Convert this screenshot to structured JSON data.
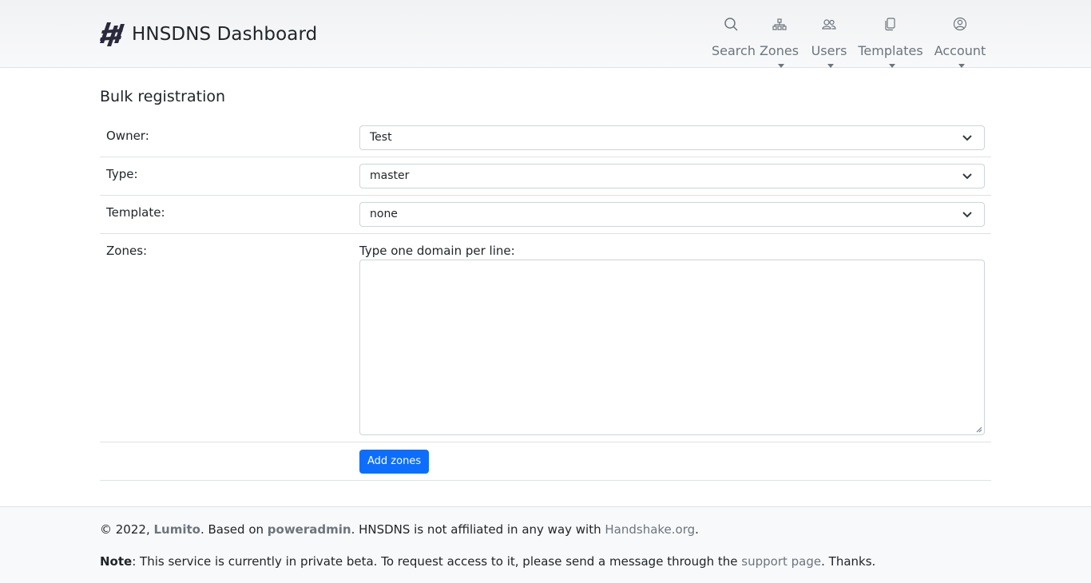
{
  "navbar": {
    "brand": "HNSDNS Dashboard",
    "items": [
      {
        "label": "Search",
        "icon": "search-icon"
      },
      {
        "label": "Zones",
        "icon": "sitemap-icon"
      },
      {
        "label": "Users",
        "icon": "users-icon"
      },
      {
        "label": "Templates",
        "icon": "copy-icon"
      },
      {
        "label": "Account",
        "icon": "user-circle-icon"
      }
    ]
  },
  "page": {
    "title": "Bulk registration"
  },
  "form": {
    "owner_label": "Owner:",
    "owner_value": "Test",
    "type_label": "Type:",
    "type_value": "master",
    "template_label": "Template:",
    "template_value": "none",
    "zones_label": "Zones:",
    "zones_hint": "Type one domain per line:",
    "zones_value": "",
    "submit_label": "Add zones"
  },
  "footer": {
    "copyright": "© 2022, ",
    "lumito": "Lumito",
    "based_on": ". Based on ",
    "poweradmin": "poweradmin",
    "not_affiliated": ". HNSDNS is not affiliated in any way with ",
    "handshake": "Handshake.org",
    "period": ".",
    "note_label": "Note",
    "note_text": ": This service is currently in private beta. To request access to it, please send a message through the ",
    "support_link": "support page",
    "note_end": ". Thanks."
  },
  "colors": {
    "primary": "#0d6efd",
    "muted": "#6c757d",
    "navbar_bg": "#f8f9fa",
    "border": "#dee2e6"
  }
}
